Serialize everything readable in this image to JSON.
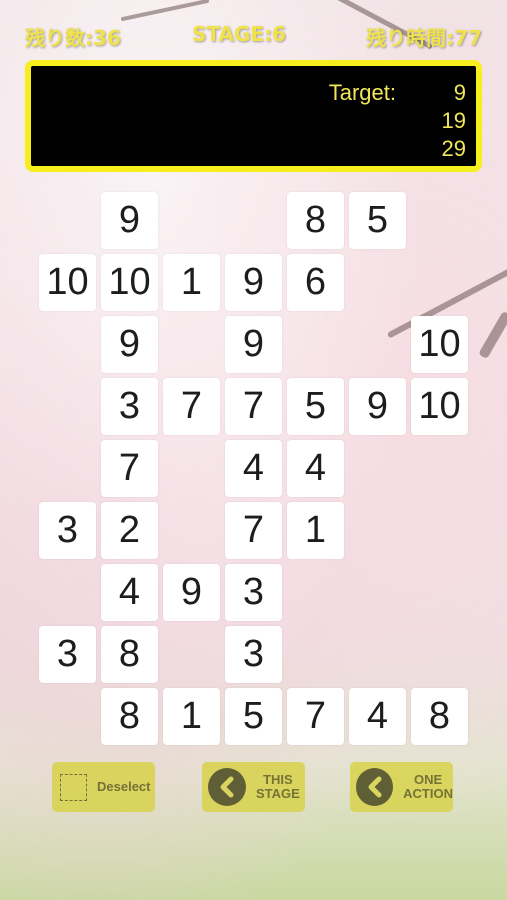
{
  "status": {
    "remaining_count": "残り数:36",
    "stage": "STAGE:6",
    "remaining_time": "残り時間:77"
  },
  "target": {
    "label": "Target:",
    "values": [
      "9",
      "19",
      "29"
    ]
  },
  "board": {
    "rows": [
      [
        "",
        "9",
        "",
        "",
        "8",
        "5",
        ""
      ],
      [
        "10",
        "10",
        "1",
        "9",
        "6",
        "",
        ""
      ],
      [
        "",
        "9",
        "",
        "9",
        "",
        "",
        "10"
      ],
      [
        "",
        "3",
        "7",
        "7",
        "5",
        "9",
        "10"
      ],
      [
        "",
        "7",
        "",
        "4",
        "4",
        "",
        ""
      ],
      [
        "3",
        "2",
        "",
        "7",
        "1",
        "",
        ""
      ],
      [
        "",
        "4",
        "9",
        "3",
        "",
        "",
        ""
      ],
      [
        "3",
        "8",
        "",
        "3",
        "",
        "",
        ""
      ],
      [
        "",
        "8",
        "1",
        "5",
        "7",
        "4",
        "8"
      ]
    ]
  },
  "buttons": {
    "deselect": "Deselect",
    "this_stage_line1": "THIS",
    "this_stage_line2": "STAGE",
    "one_action_line1": "ONE",
    "one_action_line2": "ACTION"
  },
  "icons": {
    "deselect": "dashed-square-icon",
    "back": "chevron-left-icon"
  }
}
